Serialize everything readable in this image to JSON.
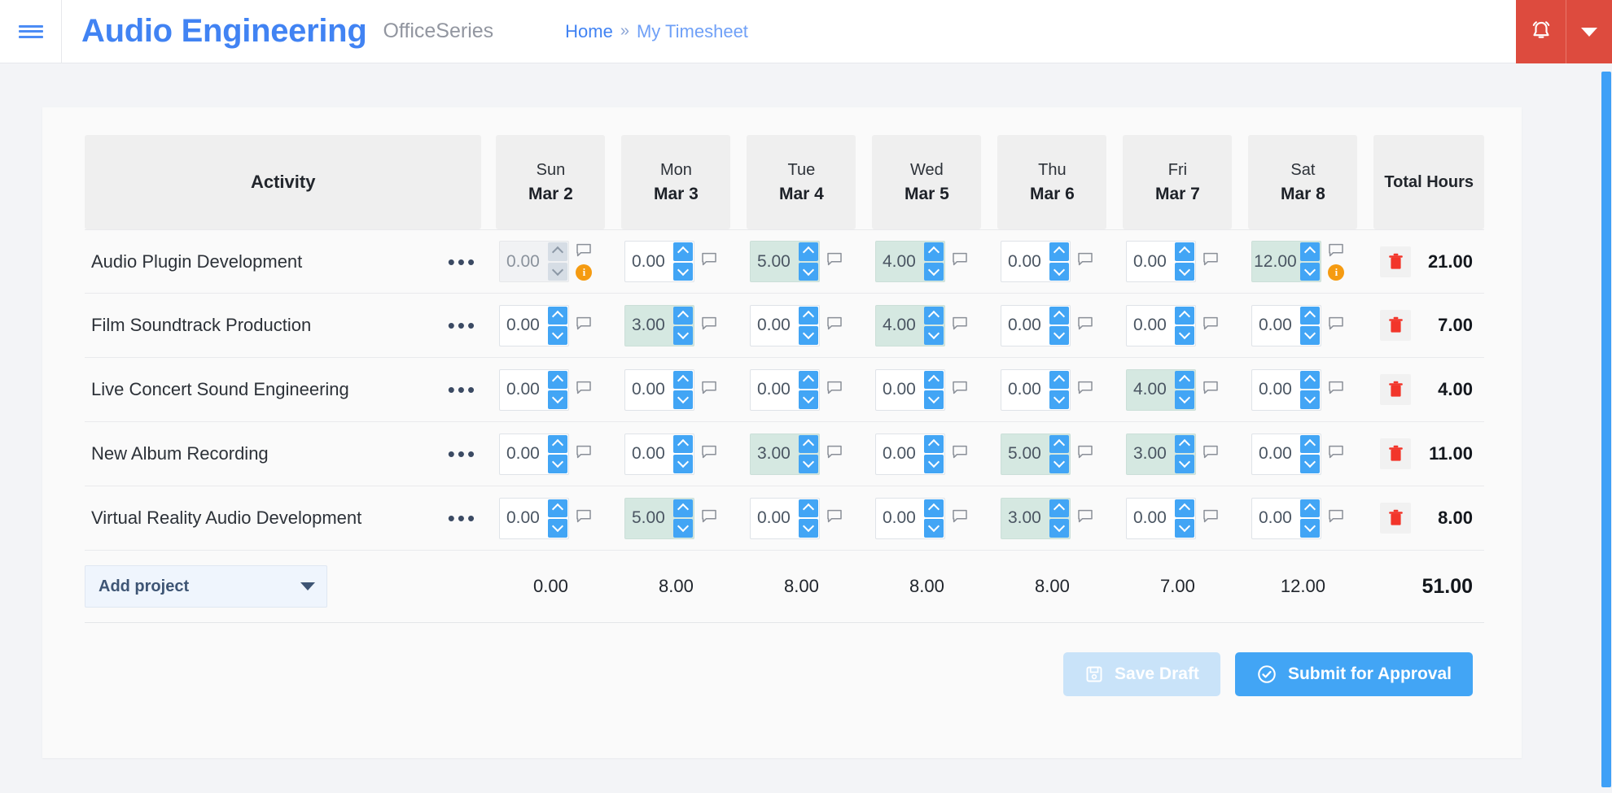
{
  "header": {
    "menu_icon": "hamburger-icon",
    "brand": "Audio Engineering",
    "suite": "OfficeSeries",
    "breadcrumb": {
      "home": "Home",
      "separator": "»",
      "current": "My Timesheet"
    },
    "alarm_icon": "alarm-bell-icon",
    "alarm_dropdown_icon": "chevron-down-icon",
    "alarm_color": "#dd4b3e",
    "brand_color": "#4183f3"
  },
  "table": {
    "activity_header": "Activity",
    "total_header": "Total Hours",
    "days": [
      {
        "dow": "Sun",
        "date": "Mar 2"
      },
      {
        "dow": "Mon",
        "date": "Mar 3"
      },
      {
        "dow": "Tue",
        "date": "Mar 4"
      },
      {
        "dow": "Wed",
        "date": "Mar 5"
      },
      {
        "dow": "Thu",
        "date": "Mar 6"
      },
      {
        "dow": "Fri",
        "date": "Mar 7"
      },
      {
        "dow": "Sat",
        "date": "Mar 8"
      }
    ],
    "row_menu_icon": "ellipsis-icon",
    "comment_icon": "comment-icon",
    "warning_icon": "info-badge-icon",
    "warning_glyph": "i",
    "delete_icon": "trash-icon",
    "rows": [
      {
        "activity": "Audio Plugin Development",
        "cells": [
          {
            "value": "0.00",
            "filled": false,
            "disabled": true,
            "warn": true
          },
          {
            "value": "0.00",
            "filled": false,
            "disabled": false,
            "warn": false
          },
          {
            "value": "5.00",
            "filled": true,
            "disabled": false,
            "warn": false
          },
          {
            "value": "4.00",
            "filled": true,
            "disabled": false,
            "warn": false
          },
          {
            "value": "0.00",
            "filled": false,
            "disabled": false,
            "warn": false
          },
          {
            "value": "0.00",
            "filled": false,
            "disabled": false,
            "warn": false
          },
          {
            "value": "12.00",
            "filled": true,
            "disabled": false,
            "warn": true
          }
        ],
        "total": "21.00"
      },
      {
        "activity": "Film Soundtrack Production",
        "cells": [
          {
            "value": "0.00",
            "filled": false,
            "disabled": false,
            "warn": false
          },
          {
            "value": "3.00",
            "filled": true,
            "disabled": false,
            "warn": false
          },
          {
            "value": "0.00",
            "filled": false,
            "disabled": false,
            "warn": false
          },
          {
            "value": "4.00",
            "filled": true,
            "disabled": false,
            "warn": false
          },
          {
            "value": "0.00",
            "filled": false,
            "disabled": false,
            "warn": false
          },
          {
            "value": "0.00",
            "filled": false,
            "disabled": false,
            "warn": false
          },
          {
            "value": "0.00",
            "filled": false,
            "disabled": false,
            "warn": false
          }
        ],
        "total": "7.00"
      },
      {
        "activity": "Live Concert Sound Engineering",
        "cells": [
          {
            "value": "0.00",
            "filled": false,
            "disabled": false,
            "warn": false
          },
          {
            "value": "0.00",
            "filled": false,
            "disabled": false,
            "warn": false
          },
          {
            "value": "0.00",
            "filled": false,
            "disabled": false,
            "warn": false
          },
          {
            "value": "0.00",
            "filled": false,
            "disabled": false,
            "warn": false
          },
          {
            "value": "0.00",
            "filled": false,
            "disabled": false,
            "warn": false
          },
          {
            "value": "4.00",
            "filled": true,
            "disabled": false,
            "warn": false
          },
          {
            "value": "0.00",
            "filled": false,
            "disabled": false,
            "warn": false
          }
        ],
        "total": "4.00"
      },
      {
        "activity": "New Album Recording",
        "cells": [
          {
            "value": "0.00",
            "filled": false,
            "disabled": false,
            "warn": false
          },
          {
            "value": "0.00",
            "filled": false,
            "disabled": false,
            "warn": false
          },
          {
            "value": "3.00",
            "filled": true,
            "disabled": false,
            "warn": false
          },
          {
            "value": "0.00",
            "filled": false,
            "disabled": false,
            "warn": false
          },
          {
            "value": "5.00",
            "filled": true,
            "disabled": false,
            "warn": false
          },
          {
            "value": "3.00",
            "filled": true,
            "disabled": false,
            "warn": false
          },
          {
            "value": "0.00",
            "filled": false,
            "disabled": false,
            "warn": false
          }
        ],
        "total": "11.00"
      },
      {
        "activity": "Virtual Reality Audio Development",
        "cells": [
          {
            "value": "0.00",
            "filled": false,
            "disabled": false,
            "warn": false
          },
          {
            "value": "5.00",
            "filled": true,
            "disabled": false,
            "warn": false
          },
          {
            "value": "0.00",
            "filled": false,
            "disabled": false,
            "warn": false
          },
          {
            "value": "0.00",
            "filled": false,
            "disabled": false,
            "warn": false
          },
          {
            "value": "3.00",
            "filled": true,
            "disabled": false,
            "warn": false
          },
          {
            "value": "0.00",
            "filled": false,
            "disabled": false,
            "warn": false
          },
          {
            "value": "0.00",
            "filled": false,
            "disabled": false,
            "warn": false
          }
        ],
        "total": "8.00"
      }
    ],
    "column_totals": [
      "0.00",
      "8.00",
      "8.00",
      "8.00",
      "8.00",
      "7.00",
      "12.00"
    ],
    "grand_total": "51.00"
  },
  "footer": {
    "add_project_label": "Add project",
    "add_project_caret_icon": "chevron-down-icon",
    "save_draft_label": "Save Draft",
    "save_draft_icon": "save-disk-icon",
    "submit_label": "Submit for Approval",
    "submit_icon": "check-circle-icon",
    "submit_color": "#42a5f5",
    "save_draft_color": "#c9e3f9"
  }
}
